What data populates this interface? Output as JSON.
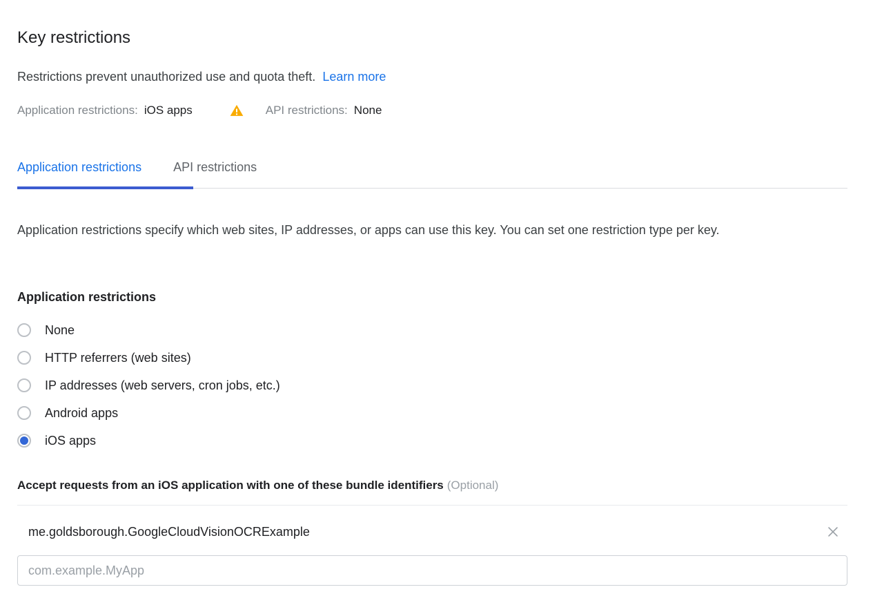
{
  "header": {
    "title": "Key restrictions",
    "description_text": "Restrictions prevent unauthorized use and quota theft.",
    "learn_more_label": "Learn more",
    "summary": {
      "application_label": "Application restrictions:",
      "application_value": "iOS apps",
      "warning_icon": "warning-triangle-icon",
      "api_label": "API restrictions:",
      "api_value": "None"
    }
  },
  "tabs": [
    {
      "label": "Application restrictions",
      "active": true
    },
    {
      "label": "API restrictions",
      "active": false
    }
  ],
  "main": {
    "description": "Application restrictions specify which web sites, IP addresses, or apps can use this key. You can set one restriction type per key.",
    "section_heading": "Application restrictions",
    "radio_options": [
      {
        "label": "None",
        "selected": false
      },
      {
        "label": "HTTP referrers (web sites)",
        "selected": false
      },
      {
        "label": "IP addresses (web servers, cron jobs, etc.)",
        "selected": false
      },
      {
        "label": "Android apps",
        "selected": false
      },
      {
        "label": "iOS apps",
        "selected": true
      }
    ],
    "bundle_section": {
      "heading": "Accept requests from an iOS application with one of these bundle identifiers",
      "optional_label": "(Optional)",
      "entries": [
        {
          "value": "me.goldsborough.GoogleCloudVisionOCRExample",
          "remove_icon": "close-icon"
        }
      ],
      "new_entry_placeholder": "com.example.MyApp",
      "new_entry_value": ""
    }
  },
  "colors": {
    "accent_blue": "#1a73e8",
    "tab_underline": "#3c5cd0",
    "radio_selected": "#3367d6",
    "warning_amber": "#f9ab00",
    "text_primary": "#202124",
    "text_secondary": "#5f6368",
    "text_muted": "#9aa0a6",
    "divider": "#dadce0"
  }
}
